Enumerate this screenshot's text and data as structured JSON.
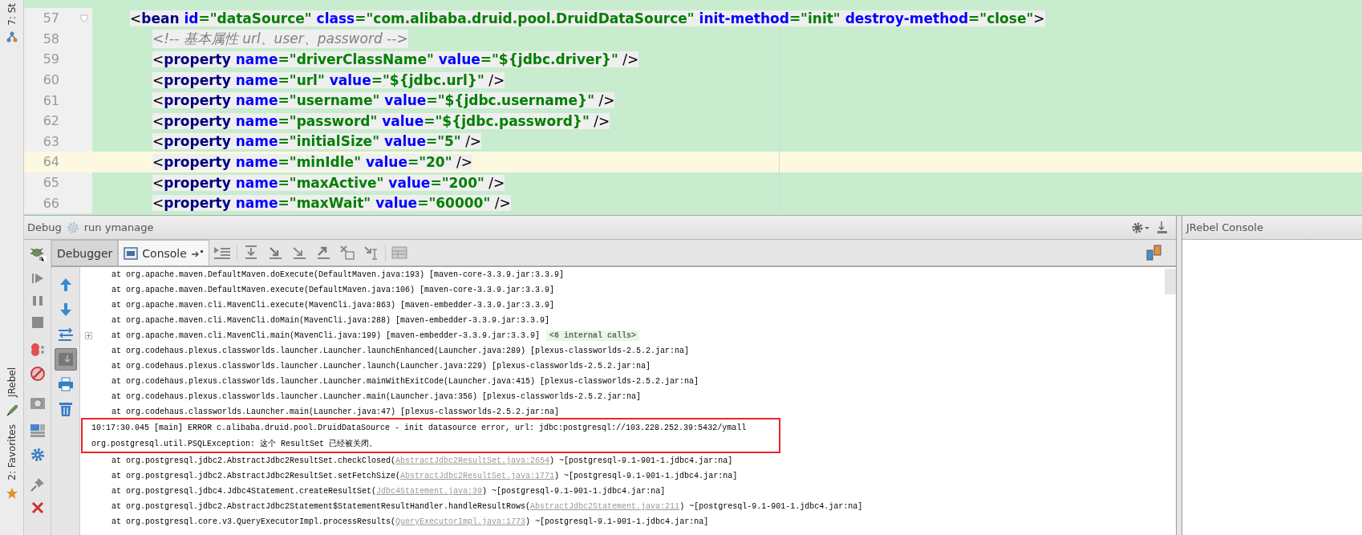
{
  "left_strip": {
    "top_label": "7: St",
    "bottom_items": [
      {
        "kind": "jrebel",
        "label": "JRebel"
      },
      {
        "kind": "favorites",
        "label": "2: Favorites"
      }
    ]
  },
  "editor": {
    "lines": [
      {
        "number": "57",
        "current": false,
        "tokens": [
          {
            "kind": "punct",
            "text": "<"
          },
          {
            "kind": "tag",
            "text": "bean"
          },
          {
            "kind": "attr",
            "text": " id"
          },
          {
            "kind": "value",
            "text": "=\"dataSource\""
          },
          {
            "kind": "attr",
            "text": " class"
          },
          {
            "kind": "value",
            "text": "=\"com.alibaba.druid.pool.DruidDataSource\""
          },
          {
            "kind": "attr",
            "text": " init-method"
          },
          {
            "kind": "value",
            "text": "=\"init\""
          },
          {
            "kind": "attr",
            "text": " destroy-method"
          },
          {
            "kind": "value",
            "text": "=\"close\""
          },
          {
            "kind": "punct",
            "text": ">"
          }
        ],
        "children": [
          {
            "number": "58",
            "current": false,
            "tokens": [
              {
                "kind": "comment",
                "text": "<!-- 基本属性 url、user、password -->"
              }
            ]
          },
          {
            "number": "59",
            "current": false,
            "tokens": [
              {
                "kind": "punct",
                "text": "<"
              },
              {
                "kind": "tag",
                "text": "property"
              },
              {
                "kind": "attr",
                "text": " name"
              },
              {
                "kind": "value",
                "text": "=\"driverClassName\""
              },
              {
                "kind": "attr",
                "text": " value"
              },
              {
                "kind": "value",
                "text": "=\"${jdbc.driver}\""
              },
              {
                "kind": "punct",
                "text": " />"
              }
            ]
          },
          {
            "number": "60",
            "current": false,
            "tokens": [
              {
                "kind": "punct",
                "text": "<"
              },
              {
                "kind": "tag",
                "text": "property"
              },
              {
                "kind": "attr",
                "text": " name"
              },
              {
                "kind": "value",
                "text": "=\"url\""
              },
              {
                "kind": "attr",
                "text": " value"
              },
              {
                "kind": "value",
                "text": "=\"${jdbc.url}\""
              },
              {
                "kind": "punct",
                "text": " />"
              }
            ]
          },
          {
            "number": "61",
            "current": false,
            "tokens": [
              {
                "kind": "punct",
                "text": "<"
              },
              {
                "kind": "tag",
                "text": "property"
              },
              {
                "kind": "attr",
                "text": " name"
              },
              {
                "kind": "value",
                "text": "=\"username\""
              },
              {
                "kind": "attr",
                "text": " value"
              },
              {
                "kind": "value",
                "text": "=\"${jdbc.username}\""
              },
              {
                "kind": "punct",
                "text": " />"
              }
            ]
          },
          {
            "number": "62",
            "current": false,
            "tokens": [
              {
                "kind": "punct",
                "text": "<"
              },
              {
                "kind": "tag",
                "text": "property"
              },
              {
                "kind": "attr",
                "text": " name"
              },
              {
                "kind": "value",
                "text": "=\"password\""
              },
              {
                "kind": "attr",
                "text": " value"
              },
              {
                "kind": "value",
                "text": "=\"${jdbc.password}\""
              },
              {
                "kind": "punct",
                "text": " />"
              }
            ]
          },
          {
            "number": "63",
            "current": false,
            "tokens": [
              {
                "kind": "punct",
                "text": "<"
              },
              {
                "kind": "tag",
                "text": "property"
              },
              {
                "kind": "attr",
                "text": " name"
              },
              {
                "kind": "value",
                "text": "=\"initialSize\""
              },
              {
                "kind": "attr",
                "text": " value"
              },
              {
                "kind": "value",
                "text": "=\"5\""
              },
              {
                "kind": "punct",
                "text": " />"
              }
            ]
          },
          {
            "number": "64",
            "current": true,
            "tokens": [
              {
                "kind": "punct",
                "text": "<"
              },
              {
                "kind": "tag",
                "text": "property"
              },
              {
                "kind": "attr",
                "text": " name"
              },
              {
                "kind": "value",
                "text": "=\"minIdle\""
              },
              {
                "kind": "attr",
                "text": " value"
              },
              {
                "kind": "value",
                "text": "=\"20\""
              },
              {
                "kind": "punct",
                "text": " />"
              }
            ]
          },
          {
            "number": "65",
            "current": false,
            "tokens": [
              {
                "kind": "punct",
                "text": "<"
              },
              {
                "kind": "tag",
                "text": "property"
              },
              {
                "kind": "attr",
                "text": " name"
              },
              {
                "kind": "value",
                "text": "=\"maxActive\""
              },
              {
                "kind": "attr",
                "text": " value"
              },
              {
                "kind": "value",
                "text": "=\"200\""
              },
              {
                "kind": "punct",
                "text": " />"
              }
            ]
          },
          {
            "number": "66",
            "current": false,
            "tokens": [
              {
                "kind": "punct",
                "text": "<"
              },
              {
                "kind": "tag",
                "text": "property"
              },
              {
                "kind": "attr",
                "text": " name"
              },
              {
                "kind": "value",
                "text": "=\"maxWait\""
              },
              {
                "kind": "attr",
                "text": " value"
              },
              {
                "kind": "value",
                "text": "=\"60000\""
              },
              {
                "kind": "punct",
                "text": " />"
              }
            ]
          }
        ]
      }
    ]
  },
  "debug": {
    "title": "Debug",
    "config": "run ymanage",
    "tabs": [
      {
        "label": "Debugger",
        "selected": false
      },
      {
        "label": "Console",
        "selected": true
      }
    ],
    "side_tools": [
      {
        "kind": "up",
        "pressed": false
      },
      {
        "kind": "down",
        "pressed": false
      },
      {
        "kind": "wrap",
        "pressed": false
      },
      {
        "kind": "scroll",
        "pressed": true
      },
      {
        "kind": "print",
        "pressed": false
      },
      {
        "kind": "trash",
        "pressed": false
      }
    ]
  },
  "console": {
    "lines": [
      {
        "kind": "frame",
        "boxed": false,
        "text": "at org.apache.maven.DefaultMaven.doExecute(DefaultMaven.java:193) [maven-core-3.3.9.jar:3.3.9]"
      },
      {
        "kind": "frame",
        "boxed": false,
        "text": "at org.apache.maven.DefaultMaven.execute(DefaultMaven.java:106) [maven-core-3.3.9.jar:3.3.9]"
      },
      {
        "kind": "frame",
        "boxed": false,
        "text": "at org.apache.maven.cli.MavenCli.execute(MavenCli.java:863) [maven-embedder-3.3.9.jar:3.3.9]"
      },
      {
        "kind": "frame",
        "boxed": false,
        "text": "at org.apache.maven.cli.MavenCli.doMain(MavenCli.java:288) [maven-embedder-3.3.9.jar:3.3.9]"
      },
      {
        "kind": "frame",
        "boxed": false,
        "text": "at org.apache.maven.cli.MavenCli.main(MavenCli.java:199) [maven-embedder-3.3.9.jar:3.3.9]",
        "collapsed_calls": "<6 internal calls>"
      },
      {
        "kind": "frame",
        "boxed": false,
        "text": "at org.codehaus.plexus.classworlds.launcher.Launcher.launchEnhanced(Launcher.java:289) [plexus-classworlds-2.5.2.jar:na]"
      },
      {
        "kind": "frame",
        "boxed": false,
        "text": "at org.codehaus.plexus.classworlds.launcher.Launcher.launch(Launcher.java:229) [plexus-classworlds-2.5.2.jar:na]"
      },
      {
        "kind": "frame",
        "boxed": false,
        "text": "at org.codehaus.plexus.classworlds.launcher.Launcher.mainWithExitCode(Launcher.java:415) [plexus-classworlds-2.5.2.jar:na]"
      },
      {
        "kind": "frame",
        "boxed": false,
        "text": "at org.codehaus.plexus.classworlds.launcher.Launcher.main(Launcher.java:356) [plexus-classworlds-2.5.2.jar:na]"
      },
      {
        "kind": "frame",
        "boxed": false,
        "text": "at org.codehaus.classworlds.Launcher.main(Launcher.java:47) [plexus-classworlds-2.5.2.jar:na]"
      },
      {
        "kind": "log",
        "boxed": true,
        "text": "10:17:30.045 [main] ERROR c.alibaba.druid.pool.DruidDataSource - init datasource error, url: jdbc:postgresql://103.228.252.39:5432/ymall"
      },
      {
        "kind": "log",
        "boxed": true,
        "text": "org.postgresql.util.PSQLException: 这个 ResultSet 已经被关闭。"
      },
      {
        "kind": "frame",
        "boxed": false,
        "text": "at org.postgresql.jdbc2.AbstractJdbc2ResultSet.checkClosed(",
        "link": "AbstractJdbc2ResultSet.java:2654",
        "suffix": ") ~[postgresql-9.1-901-1.jdbc4.jar:na]"
      },
      {
        "kind": "frame",
        "boxed": false,
        "text": "at org.postgresql.jdbc2.AbstractJdbc2ResultSet.setFetchSize(",
        "link": "AbstractJdbc2ResultSet.java:1771",
        "suffix": ") ~[postgresql-9.1-901-1.jdbc4.jar:na]"
      },
      {
        "kind": "frame",
        "boxed": false,
        "text": "at org.postgresql.jdbc4.Jdbc4Statement.createResultSet(",
        "link": "Jdbc4Statement.java:39",
        "suffix": ") ~[postgresql-9.1-901-1.jdbc4.jar:na]"
      },
      {
        "kind": "frame",
        "boxed": false,
        "text": "at org.postgresql.jdbc2.AbstractJdbc2Statement$StatementResultHandler.handleResultRows(",
        "link": "AbstractJdbc2Statement.java:211",
        "suffix": ") ~[postgresql-9.1-901-1.jdbc4.jar:na]"
      },
      {
        "kind": "frame",
        "boxed": false,
        "text": "at org.postgresql.core.v3.QueryExecutorImpl.processResults(",
        "link": "QueryExecutorImpl.java:1773",
        "suffix": ") ~[postgresql-9.1-901-1.jdbc4.jar:na]"
      }
    ]
  },
  "jrebel": {
    "title": "JRebel Console"
  }
}
